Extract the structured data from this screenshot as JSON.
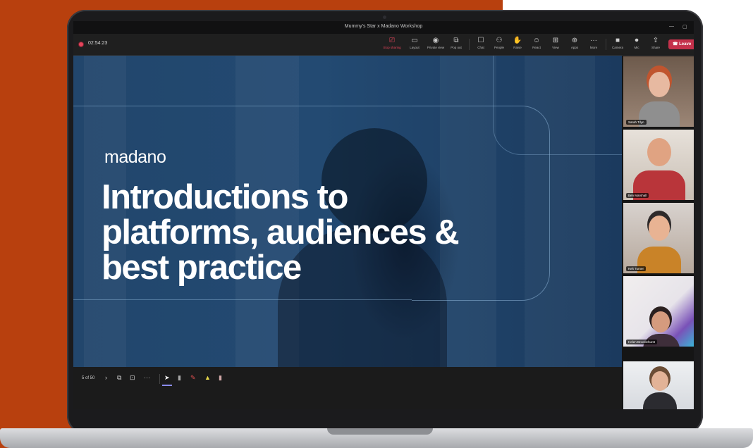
{
  "window": {
    "title": "Mummy's Star x Madano Workshop",
    "minimize": "—",
    "maximize": "▢"
  },
  "call": {
    "timer": "02:54:23"
  },
  "toolbar": {
    "items": [
      {
        "label": "Stop sharing",
        "icon": "stop-share-icon",
        "glyph": "⎚"
      },
      {
        "label": "Layout",
        "icon": "layout-icon",
        "glyph": "▭"
      },
      {
        "label": "Private view",
        "icon": "private-view-icon",
        "glyph": "◉"
      },
      {
        "label": "Pop out",
        "icon": "pop-out-icon",
        "glyph": "⧉"
      },
      {
        "label": "Chat",
        "icon": "chat-icon",
        "glyph": "☐"
      },
      {
        "label": "People",
        "icon": "people-icon",
        "glyph": "⚇"
      },
      {
        "label": "Raise",
        "icon": "raise-hand-icon",
        "glyph": "✋"
      },
      {
        "label": "React",
        "icon": "react-icon",
        "glyph": "☺"
      },
      {
        "label": "View",
        "icon": "view-icon",
        "glyph": "⊞"
      },
      {
        "label": "Apps",
        "icon": "apps-icon",
        "glyph": "⊕"
      },
      {
        "label": "More",
        "icon": "more-icon",
        "glyph": "···"
      },
      {
        "label": "Camera",
        "icon": "camera-icon",
        "glyph": "■"
      },
      {
        "label": "Mic",
        "icon": "mic-icon",
        "glyph": "⏺"
      },
      {
        "label": "Share",
        "icon": "share-icon",
        "glyph": "⇪"
      }
    ],
    "leave_label": "Leave",
    "leave_icon": "phone-hangup-icon"
  },
  "slide": {
    "brand": "madano",
    "title_lines": [
      "Introductions to",
      "platforms, audiences &",
      "best practice"
    ]
  },
  "presenter": {
    "counter": "5 of 50"
  },
  "participants": [
    {
      "name": "Sarah Tilyn"
    },
    {
      "name": "Ben Marshall"
    },
    {
      "name": "Kelt Turner"
    },
    {
      "name": "Helen Brocklehurst"
    },
    {
      "name": ""
    }
  ],
  "colors": {
    "background_accent": "#b8400e",
    "leave_red": "#c4314b",
    "slide_blue": "#234a72",
    "record_red": "#e4455b"
  }
}
